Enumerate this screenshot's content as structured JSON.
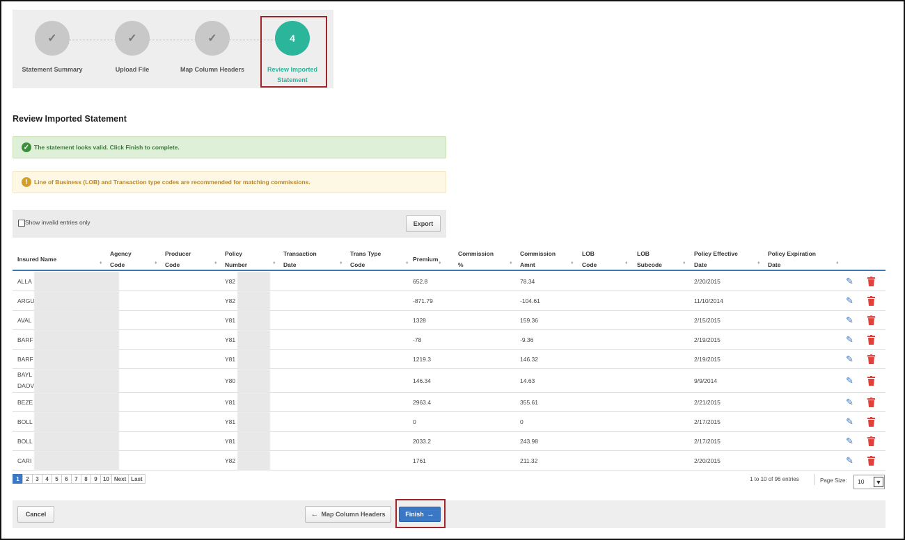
{
  "wizard": {
    "steps": [
      {
        "label": "Statement Summary",
        "state": "done"
      },
      {
        "label": "Upload File",
        "state": "done"
      },
      {
        "label": "Map Column Headers",
        "state": "done"
      },
      {
        "label": "Review Imported Statement",
        "label_lines": [
          "Review Imported",
          "Statement"
        ],
        "number": "4",
        "state": "active"
      }
    ]
  },
  "page_title": "Review Imported Statement",
  "alerts": {
    "success": "The statement looks valid. Click Finish to complete.",
    "warning": "Line of Business (LOB) and Transaction type codes are recommended for matching commissions."
  },
  "filter": {
    "show_invalid_label": "Show invalid entries only",
    "checked": false,
    "export_label": "Export"
  },
  "table": {
    "columns": [
      [
        "Insured Name"
      ],
      [
        "Agency",
        "Code"
      ],
      [
        "Producer",
        "Code"
      ],
      [
        "Policy",
        "Number"
      ],
      [
        "Transaction",
        "Date"
      ],
      [
        "Trans Type",
        "Code"
      ],
      [
        "Premium"
      ],
      [
        "Commission",
        "%"
      ],
      [
        "Commission",
        "Amnt"
      ],
      [
        "LOB",
        "Code"
      ],
      [
        "LOB",
        "Subcode"
      ],
      [
        "Policy Effective",
        "Date"
      ],
      [
        "Policy Expiration",
        "Date"
      ]
    ],
    "rows": [
      {
        "name": "ALLA",
        "policy": "Y82",
        "premium": "652.8",
        "comm_amt": "78.34",
        "eff_date": "2/20/2015"
      },
      {
        "name": "ARGU",
        "policy": "Y82",
        "premium": "-871.79",
        "comm_amt": "-104.61",
        "eff_date": "11/10/2014"
      },
      {
        "name": "AVAL",
        "policy": "Y81",
        "premium": "1328",
        "comm_amt": "159.36",
        "eff_date": "2/15/2015"
      },
      {
        "name": "BARF",
        "policy": "Y81",
        "premium": "-78",
        "comm_amt": "-9.36",
        "eff_date": "2/19/2015"
      },
      {
        "name": "BARF",
        "policy": "Y81",
        "premium": "1219.3",
        "comm_amt": "146.32",
        "eff_date": "2/19/2015"
      },
      {
        "name": "BAYL",
        "name2": "DAOV",
        "policy": "Y80",
        "premium": "146.34",
        "comm_amt": "14.63",
        "eff_date": "9/9/2014"
      },
      {
        "name": "BEZE",
        "policy": "Y81",
        "premium": "2963.4",
        "comm_amt": "355.61",
        "eff_date": "2/21/2015"
      },
      {
        "name": "BOLL",
        "policy": "Y81",
        "premium": "0",
        "comm_amt": "0",
        "eff_date": "2/17/2015"
      },
      {
        "name": "BOLL",
        "policy": "Y81",
        "premium": "2033.2",
        "comm_amt": "243.98",
        "eff_date": "2/17/2015"
      },
      {
        "name": "CARI",
        "policy": "Y82",
        "premium": "1761",
        "comm_amt": "211.32",
        "eff_date": "2/20/2015"
      }
    ],
    "icons": {
      "edit": "pencil-icon",
      "delete": "trash-icon"
    }
  },
  "pagination": {
    "pages": [
      "1",
      "2",
      "3",
      "4",
      "5",
      "6",
      "7",
      "8",
      "9",
      "10"
    ],
    "current": "1",
    "next_label": "Next",
    "last_label": "Last",
    "entries_text": "1 to 10 of 96 entries",
    "page_size_label": "Page Size:",
    "page_size_value": "10"
  },
  "footer": {
    "cancel_label": "Cancel",
    "back_label": "Map Column Headers",
    "finish_label": "Finish"
  },
  "colors": {
    "accent": "#2bb59a",
    "primary": "#3a78c5",
    "highlight": "#a0252b",
    "delete": "#e0413a"
  }
}
